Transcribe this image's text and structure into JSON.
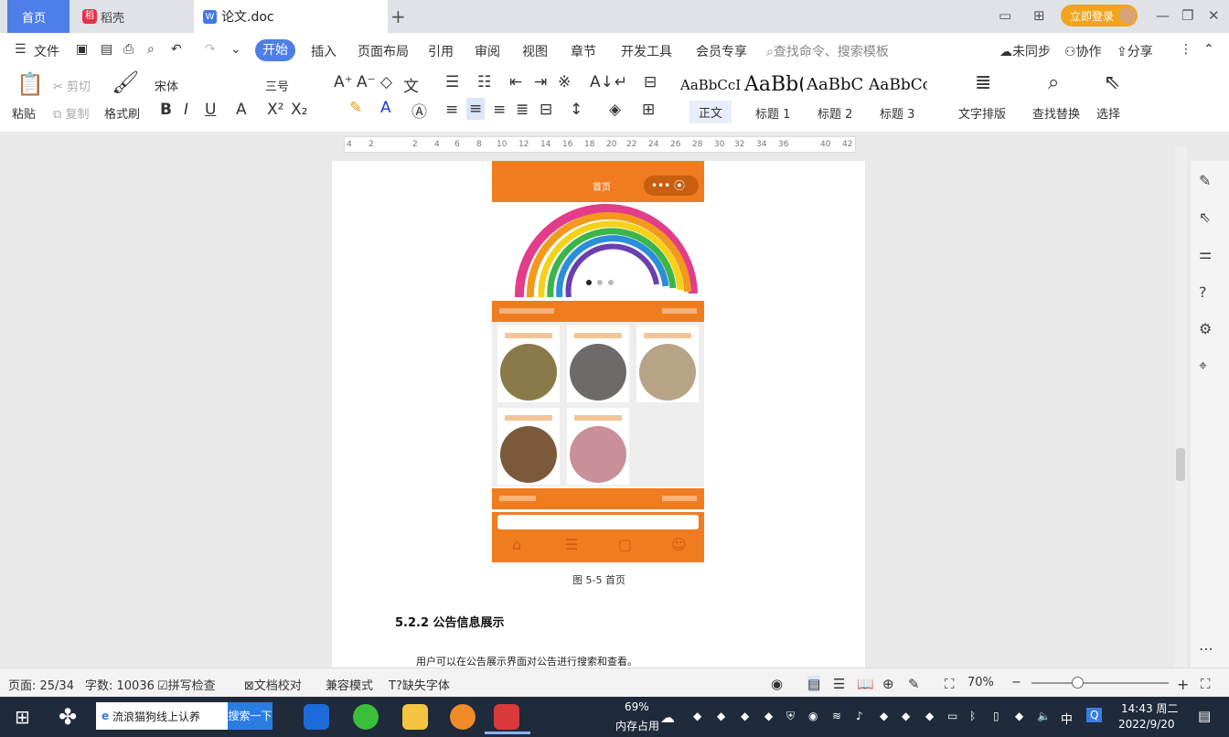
{
  "tabs": {
    "home": "首页",
    "docer": "稻壳",
    "doc": "论文.doc",
    "add": "+",
    "login": "立即登录"
  },
  "menu": {
    "file": "文件",
    "items": [
      "开始",
      "插入",
      "页面布局",
      "引用",
      "审阅",
      "视图",
      "章节",
      "开发工具",
      "会员专享"
    ],
    "search_placeholder": "查找命令、搜索模板",
    "sync": "未同步",
    "collab": "协作",
    "share": "分享"
  },
  "ribbon": {
    "paste": "粘贴",
    "cut": "剪切",
    "copy": "复制",
    "format_painter": "格式刷",
    "font": "宋体",
    "size": "三号",
    "styles": [
      {
        "preview": "AaBbCcI",
        "label": "正文"
      },
      {
        "preview": "AaBb(",
        "label": "标题 1"
      },
      {
        "preview": "AaBbC",
        "label": "标题 2"
      },
      {
        "preview": "AaBbCc",
        "label": "标题 3"
      }
    ],
    "text_layout": "文字排版",
    "find_replace": "查找替换",
    "select": "选择"
  },
  "ruler": [
    "4",
    "2",
    "2",
    "4",
    "6",
    "8",
    "10",
    "12",
    "14",
    "16",
    "18",
    "20",
    "22",
    "24",
    "26",
    "28",
    "30",
    "32",
    "34",
    "36",
    "40",
    "42"
  ],
  "document": {
    "phone_title": "首页",
    "caption": "图 5-5  首页",
    "heading": "5.2.2  公告信息展示",
    "paragraph": "用户可以在公告展示界面对公告进行搜索和查看。"
  },
  "status": {
    "page": "页面: 25/34",
    "words": "字数: 10036",
    "spell": "拼写检查",
    "proof": "文档校对",
    "compat": "兼容模式",
    "missing_font": "缺失字体",
    "zoom": "70%"
  },
  "taskbar": {
    "search_text": "流浪猫狗线上认养",
    "search_button": "搜索一下",
    "memory_pct": "69%",
    "memory_label": "内存占用",
    "ime": "中",
    "time": "14:43 周二",
    "date": "2022/9/20"
  },
  "colors": {
    "accent": "#4e7fe8",
    "orange": "#f07c20",
    "login": "#f1a41e"
  }
}
